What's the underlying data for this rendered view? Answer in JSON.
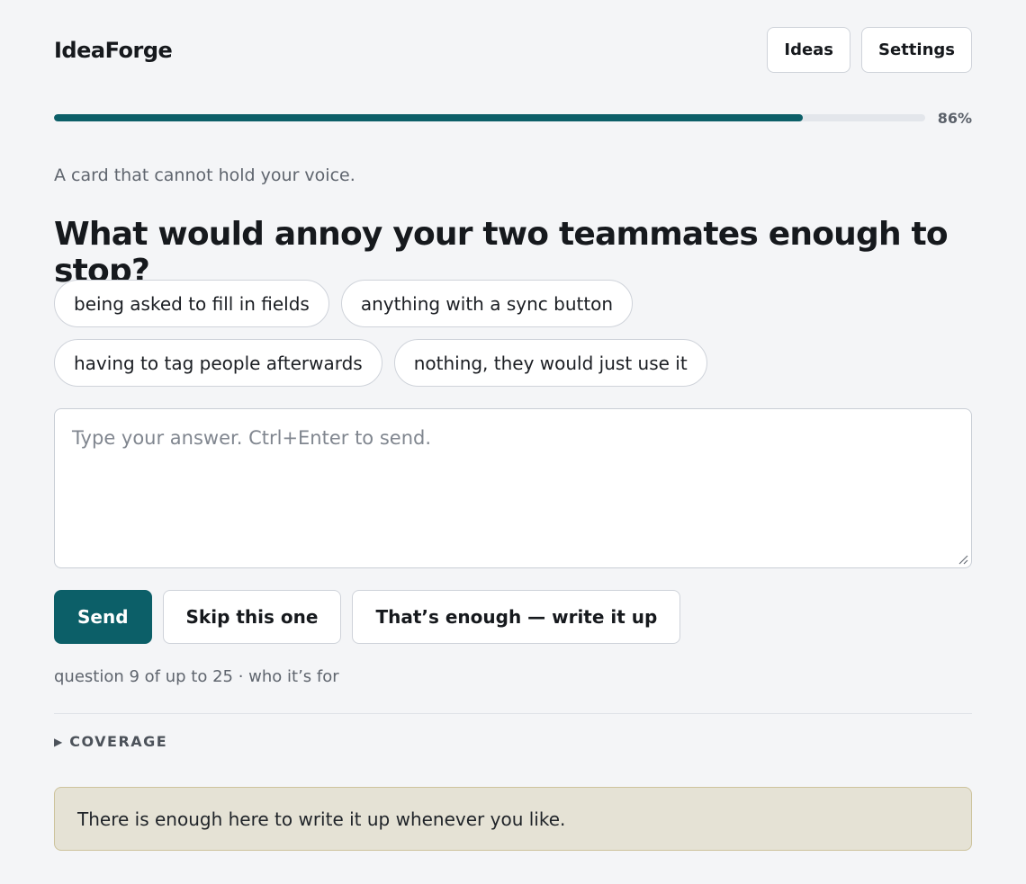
{
  "header": {
    "brand": "IdeaForge",
    "nav": [
      "Ideas",
      "Settings"
    ]
  },
  "progress": {
    "percent_label": "86%",
    "value": 0.86
  },
  "subtitle": "A card that cannot hold your voice.",
  "question": "What would annoy your two teammates enough to stop?",
  "chips": [
    "being asked to fill in fields",
    "anything with a sync button",
    "having to tag people afterwards",
    "nothing, they would just use it"
  ],
  "answer": {
    "value": "",
    "placeholder": "Type your answer. Ctrl+Enter to send."
  },
  "actions": {
    "send": "Send",
    "skip": "Skip this one",
    "finish": "That’s enough — write it up"
  },
  "meta": "question 9 of up to 25 · who it’s for",
  "coverage": {
    "label": "COVERAGE",
    "expanded": false
  },
  "notice": "There is enough here to write it up whenever you like.",
  "colors": {
    "accent": "#0c5f68",
    "background": "#f4f5f7",
    "notice_bg": "#e5e2d5",
    "notice_border": "#cdc39c"
  }
}
